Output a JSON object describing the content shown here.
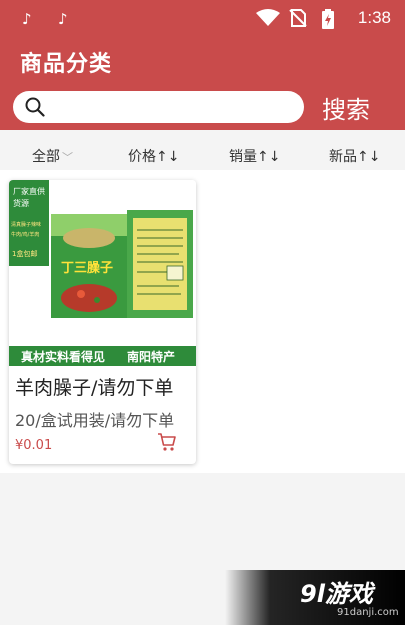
{
  "status": {
    "time": "1:38",
    "app_icon": "tiktok-icon"
  },
  "header": {
    "title": "商品分类"
  },
  "search": {
    "placeholder": "",
    "button_label": "搜索"
  },
  "sort_tabs": [
    {
      "label": "全部",
      "icon": "chevron-down-icon"
    },
    {
      "label": "价格↑↓"
    },
    {
      "label": "销量↑↓"
    },
    {
      "label": "新品↑↓"
    }
  ],
  "products": [
    {
      "title": "羊肉臊子/请勿下单",
      "desc": "20/盒试用装/请勿下单",
      "price": "¥0.01",
      "image": {
        "banner_left": "真材实料看得见",
        "banner_right": "南阳特产",
        "tag_line1": "厂家直供",
        "tag_line2": "货源",
        "tag_small": "清真臊子辣味",
        "tag_small2": "牛肉/鸡/羊肉",
        "tag_bottom": "1盒包邮",
        "box_text": "丁三臊子"
      }
    }
  ],
  "watermark": {
    "logo": "9l游戏",
    "site": "91danji.com"
  },
  "colors": {
    "accent": "#c94b4b"
  }
}
